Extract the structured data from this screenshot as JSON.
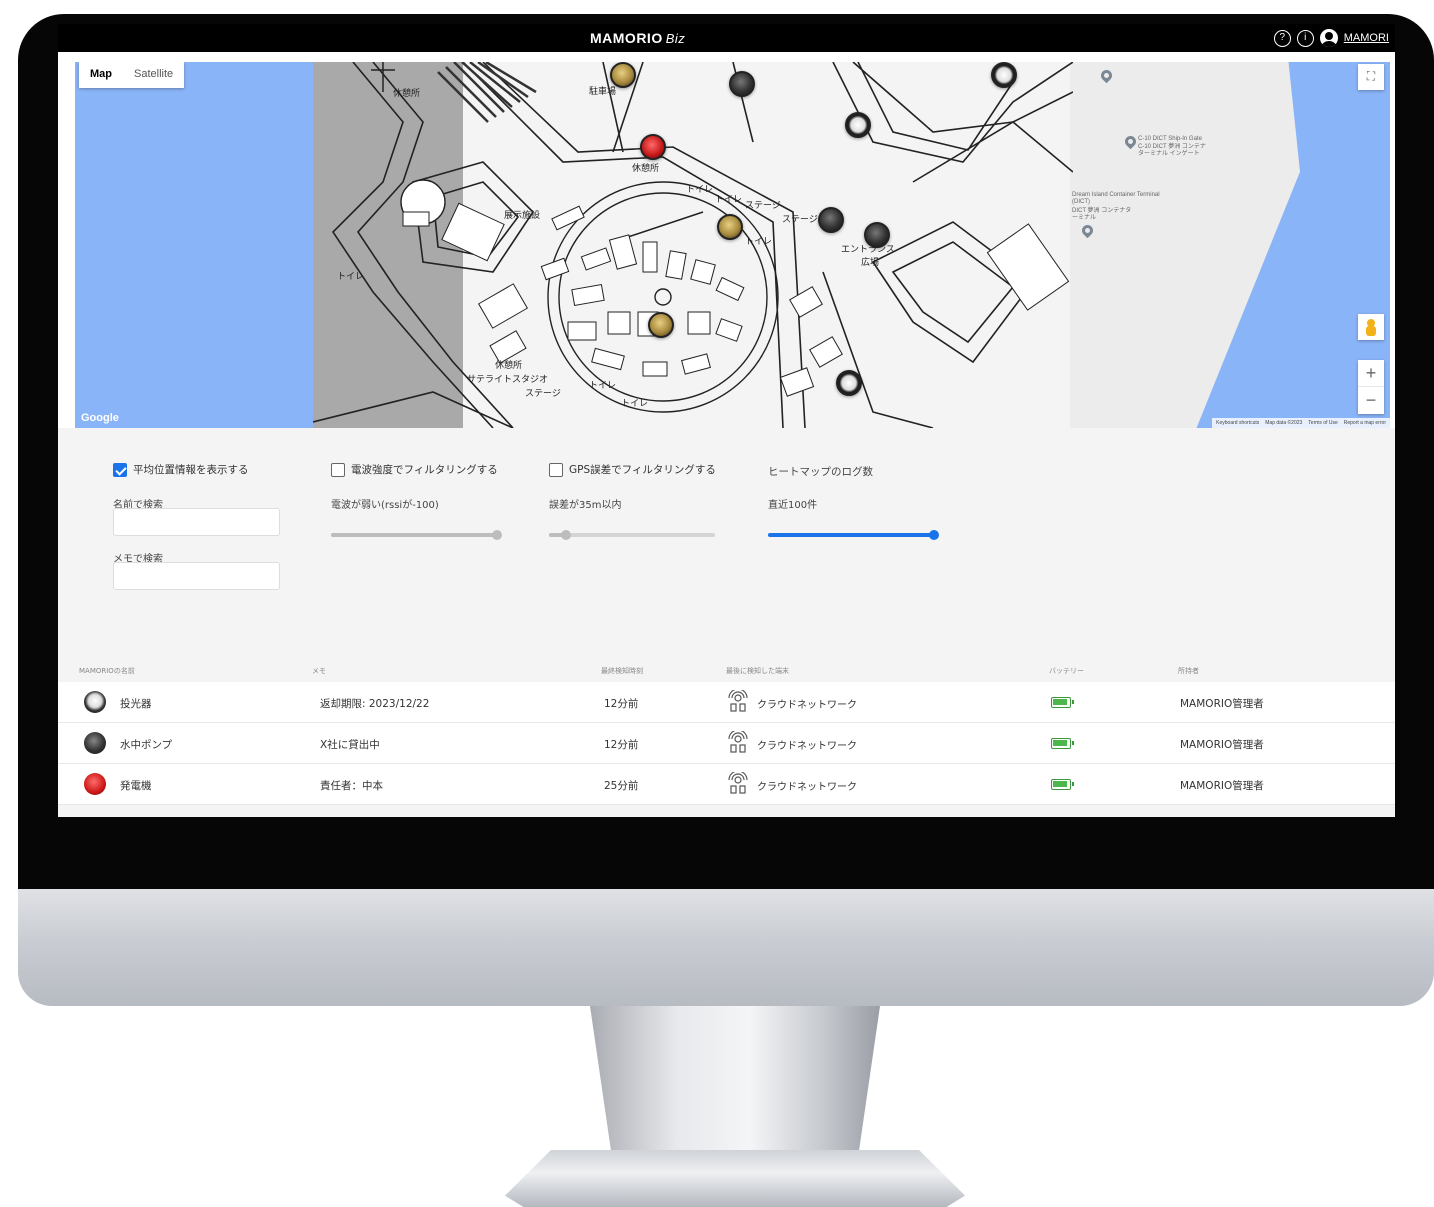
{
  "header": {
    "brand": "MAMORIO",
    "brand_suffix": "Biz",
    "help_icon_glyph": "?",
    "info_icon_glyph": "i",
    "user_name": "MAMORI"
  },
  "map": {
    "type_map": "Map",
    "type_satellite": "Satellite",
    "fullscreen_glyph": "⛶",
    "zoom_in": "+",
    "zoom_out": "−",
    "google": "Google",
    "attribution": [
      "Keyboard shortcuts",
      "Map data ©2023",
      "Terms of Use",
      "Report a map error"
    ],
    "labels": [
      {
        "text": "休憩所"
      },
      {
        "text": "駐車場"
      },
      {
        "text": "休憩所"
      },
      {
        "text": "トイレ"
      },
      {
        "text": "トイレ"
      },
      {
        "text": "ステージ"
      },
      {
        "text": "ステージ"
      },
      {
        "text": "展示施設"
      },
      {
        "text": "トイレ"
      },
      {
        "text": "トイレ"
      },
      {
        "text": "エントランス"
      },
      {
        "text": "広場"
      },
      {
        "text": "休憩所"
      },
      {
        "text": "サテライトスタジオ"
      },
      {
        "text": "ステージ"
      },
      {
        "text": "トイレ"
      },
      {
        "text": "トイレ"
      }
    ],
    "poi_1": "C-10 DICT Ship-In Gate",
    "poi_1_sub": "C-10 DICT 夢洲 コンテナ ターミナル インゲート",
    "poi_2": "Dream Island Container Terminal (DICT)",
    "poi_2_sub": "DICT 夢洲 コンテナターミナル"
  },
  "filters": {
    "avg_position": {
      "label": "平均位置情報を表示する",
      "checked": true
    },
    "signal_filter": {
      "label": "電波強度でフィルタリングする",
      "checked": false
    },
    "gps_filter": {
      "label": "GPS誤差でフィルタリングする",
      "checked": false
    },
    "heatmap_title": "ヒートマップのログ数",
    "search_name_label": "名前で検索",
    "search_name_value": "",
    "search_memo_label": "メモで検索",
    "search_memo_value": "",
    "signal_value_label": "電波が弱い(rssiが-100)",
    "gps_value_label": "誤差が35m以内",
    "heatmap_value_label": "直近100件",
    "signal_slider": 1.0,
    "gps_slider": 0.1,
    "heatmap_slider": 1.0,
    "accent": "#1a73e8"
  },
  "table": {
    "headers": [
      "MAMORIOの名前",
      "メモ",
      "最終検知時刻",
      "最後に検知した端末",
      "バッテリー",
      "所持者"
    ],
    "rows": [
      {
        "name": "投光器",
        "memo": "返却期限: 2023/12/22",
        "time": "12分前",
        "device": "クラウドネットワーク",
        "battery": 1.0,
        "owner": "MAMORIO管理者",
        "avatar": "white-icon"
      },
      {
        "name": "水中ポンプ",
        "memo": "X社に貸出中",
        "time": "12分前",
        "device": "クラウドネットワーク",
        "battery": 1.0,
        "owner": "MAMORIO管理者",
        "avatar": "dark-icon"
      },
      {
        "name": "発電機",
        "memo": "責任者：中本",
        "time": "25分前",
        "device": "クラウドネットワーク",
        "battery": 1.0,
        "owner": "MAMORIO管理者",
        "avatar": "red-icon"
      }
    ]
  }
}
